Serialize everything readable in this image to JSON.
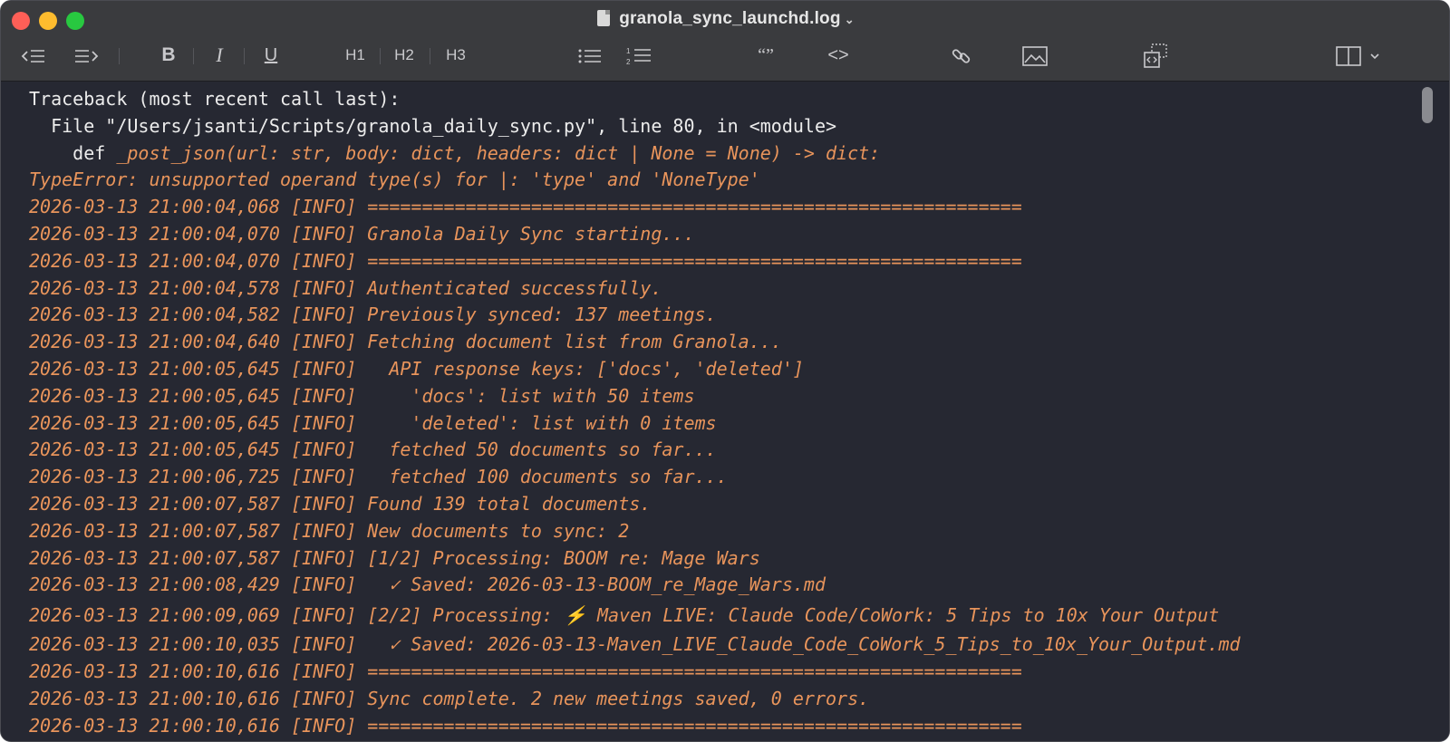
{
  "window": {
    "title": "granola_sync_launchd.log",
    "title_chevron": "⌄"
  },
  "toolbar": {
    "h1_label": "H1",
    "h2_label": "H2",
    "h3_label": "H3",
    "bold_label": "B",
    "italic_label": "I",
    "underline_label": "U",
    "quote_label": "“”",
    "code_label": "<>"
  },
  "log": {
    "traceback": [
      {
        "indent": "",
        "text": "Traceback (most recent call last):"
      },
      {
        "indent": "  ",
        "text": "File \"/Users/jsanti/Scripts/granola_daily_sync.py\", line 80, in <module>"
      }
    ],
    "def_keyword": "    def",
    "def_rest": " _post_json(url: str, body: dict, headers: dict | None = None) -> dict:",
    "error": "TypeError: unsupported operand type(s) for |: 'type' and 'NoneType'",
    "entries": [
      "2026-03-13 21:00:04,068 [INFO] ============================================================",
      "2026-03-13 21:00:04,070 [INFO] Granola Daily Sync starting...",
      "2026-03-13 21:00:04,070 [INFO] ============================================================",
      "2026-03-13 21:00:04,578 [INFO] Authenticated successfully.",
      "2026-03-13 21:00:04,582 [INFO] Previously synced: 137 meetings.",
      "2026-03-13 21:00:04,640 [INFO] Fetching document list from Granola...",
      "2026-03-13 21:00:05,645 [INFO]   API response keys: ['docs', 'deleted']",
      "2026-03-13 21:00:05,645 [INFO]     'docs': list with 50 items",
      "2026-03-13 21:00:05,645 [INFO]     'deleted': list with 0 items",
      "2026-03-13 21:00:05,645 [INFO]   fetched 50 documents so far...",
      "2026-03-13 21:00:06,725 [INFO]   fetched 100 documents so far...",
      "2026-03-13 21:00:07,587 [INFO] Found 139 total documents.",
      "2026-03-13 21:00:07,587 [INFO] New documents to sync: 2",
      "2026-03-13 21:00:07,587 [INFO] [1/2] Processing: BOOM re: Mage Wars",
      "2026-03-13 21:00:08,429 [INFO]   ✓ Saved: 2026-03-13-BOOM_re_Mage_Wars.md",
      "2026-03-13 21:00:09,069 [INFO] [2/2] Processing: ⚡ Maven LIVE: Claude Code/CoWork: 5 Tips to 10x Your Output",
      "2026-03-13 21:00:10,035 [INFO]   ✓ Saved: 2026-03-13-Maven_LIVE_Claude_Code_CoWork_5_Tips_to_10x_Your_Output.md",
      "2026-03-13 21:00:10,616 [INFO] ============================================================",
      "2026-03-13 21:00:10,616 [INFO] Sync complete. 2 new meetings saved, 0 errors.",
      "2026-03-13 21:00:10,616 [INFO] ============================================================"
    ]
  },
  "colors": {
    "log_text": "#e8945b",
    "plain_text": "#ececec",
    "background": "#262832"
  }
}
